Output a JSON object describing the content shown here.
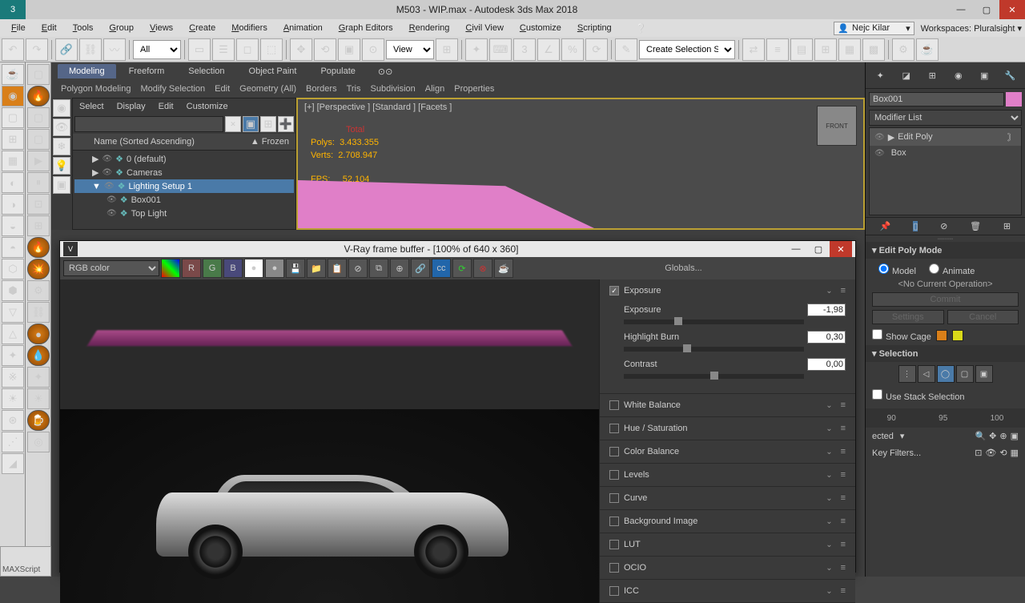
{
  "titlebar": {
    "title": "M503 - WIP.max - Autodesk 3ds Max 2018"
  },
  "menus": [
    "File",
    "Edit",
    "Tools",
    "Group",
    "Views",
    "Create",
    "Modifiers",
    "Animation",
    "Graph Editors",
    "Rendering",
    "Civil View",
    "Customize",
    "Scripting"
  ],
  "user": "Nejc Kilar",
  "workspace_label": "Workspaces:",
  "workspace_value": "Pluralsight",
  "toolbar": {
    "filter": "All",
    "view": "View",
    "selset": "Create Selection Se"
  },
  "ribbon": {
    "tabs": [
      "Modeling",
      "Freeform",
      "Selection",
      "Object Paint",
      "Populate"
    ],
    "active": 0,
    "sub": [
      "Polygon Modeling",
      "Modify Selection",
      "Edit",
      "Geometry (All)",
      "Borders",
      "Tris",
      "Subdivision",
      "Align",
      "Properties"
    ]
  },
  "scene": {
    "tabs": [
      "Select",
      "Display",
      "Edit",
      "Customize"
    ],
    "header": {
      "name": "Name (Sorted Ascending)",
      "frozen": "▲ Frozen"
    },
    "tree": [
      {
        "name": "0 (default)",
        "depth": 1,
        "exp": "▶",
        "sel": false
      },
      {
        "name": "Cameras",
        "depth": 1,
        "exp": "▶",
        "sel": false
      },
      {
        "name": "Lighting Setup 1",
        "depth": 1,
        "exp": "▼",
        "sel": true
      },
      {
        "name": "Box001",
        "depth": 2,
        "exp": "",
        "sel": false
      },
      {
        "name": "Top Light",
        "depth": 2,
        "exp": "",
        "sel": false
      }
    ]
  },
  "viewport": {
    "label": "[+] [Perspective ] [Standard ] [Facets ]",
    "stats": {
      "total_h": "Total",
      "polys_l": "Polys:",
      "polys_v": "3.433.355",
      "verts_l": "Verts:",
      "verts_v": "2.708.947",
      "fps_l": "FPS:",
      "fps_v": "52,104"
    },
    "cube": "FRONT"
  },
  "vfb": {
    "title": "V-Ray frame buffer - [100% of 640 x 360]",
    "channel": "RGB color",
    "globals": "Globals...",
    "sections": [
      {
        "name": "Exposure",
        "enabled": true,
        "open": true,
        "controls": [
          {
            "label": "Exposure",
            "value": "-1,98",
            "pos": 30
          },
          {
            "label": "Highlight Burn",
            "value": "0,30",
            "pos": 35
          },
          {
            "label": "Contrast",
            "value": "0,00",
            "pos": 50
          }
        ]
      },
      {
        "name": "White Balance",
        "enabled": false,
        "open": false
      },
      {
        "name": "Hue / Saturation",
        "enabled": false,
        "open": false
      },
      {
        "name": "Color Balance",
        "enabled": false,
        "open": false
      },
      {
        "name": "Levels",
        "enabled": false,
        "open": false
      },
      {
        "name": "Curve",
        "enabled": false,
        "open": false
      },
      {
        "name": "Background Image",
        "enabled": false,
        "open": false
      },
      {
        "name": "LUT",
        "enabled": false,
        "open": false
      },
      {
        "name": "OCIO",
        "enabled": false,
        "open": false
      },
      {
        "name": "ICC",
        "enabled": false,
        "open": false
      }
    ]
  },
  "command_panel": {
    "name": "Box001",
    "modlist": "Modifier List",
    "stack": [
      {
        "name": "Edit Poly",
        "sel": true,
        "arrow": "▶"
      },
      {
        "name": "Box",
        "sel": false,
        "arrow": ""
      }
    ],
    "rollout1": "Edit Poly Mode",
    "model": "Model",
    "animate": "Animate",
    "noop": "<No Current Operation>",
    "commit": "Commit",
    "settings": "Settings",
    "cancel": "Cancel",
    "showcage": "Show Cage",
    "rollout2": "Selection",
    "use_stack": "Use Stack Selection",
    "ruler": [
      "90",
      "95",
      "100"
    ],
    "filter_label": "ected",
    "key_filters": "Key Filters..."
  },
  "maxscript": "MAXScript"
}
